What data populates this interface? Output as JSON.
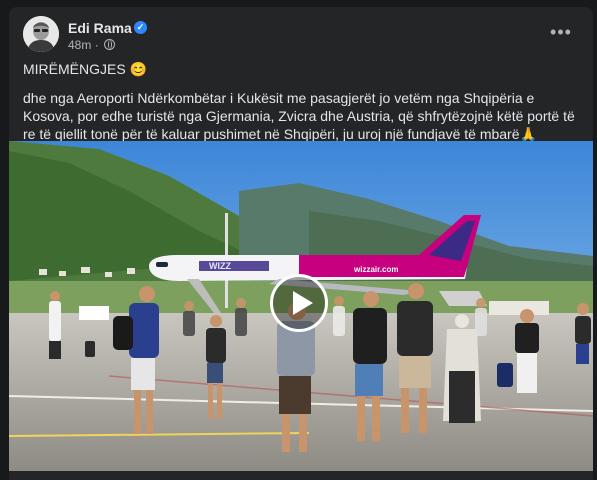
{
  "post": {
    "author": "Edi Rama",
    "verified_icon": "verified-badge-icon",
    "time": "48m",
    "privacy_icon": "globe-icon",
    "more_icon": "more-options-icon",
    "greeting": "MIRËMËNGJES",
    "greeting_emoji": "😊",
    "body": "dhe nga Aeroporti Ndërkombëtar i Kukësit me pasagjerët jo vetëm nga Shqipëria e Kosova, por edhe turistë nga Gjermania, Zvicra dhe Austria, që shfrytëzojnë këtë portë të re të qiellit tonë për të kaluar pushimet në Shqipëri, ju uroj një fundjavë të mbarë",
    "body_emoji": "🙏"
  },
  "media": {
    "type": "video",
    "airline_livery": "wizzair.com",
    "aircraft_brand": "WIZZ",
    "play_icon": "play-icon"
  },
  "colors": {
    "background": "#18191a",
    "card": "#242526",
    "text": "#e4e6eb",
    "secondary_text": "#b0b3b8",
    "verified": "#2d88ff",
    "wizz_pink": "#c6007e",
    "wizz_purple": "#3c2a87"
  }
}
